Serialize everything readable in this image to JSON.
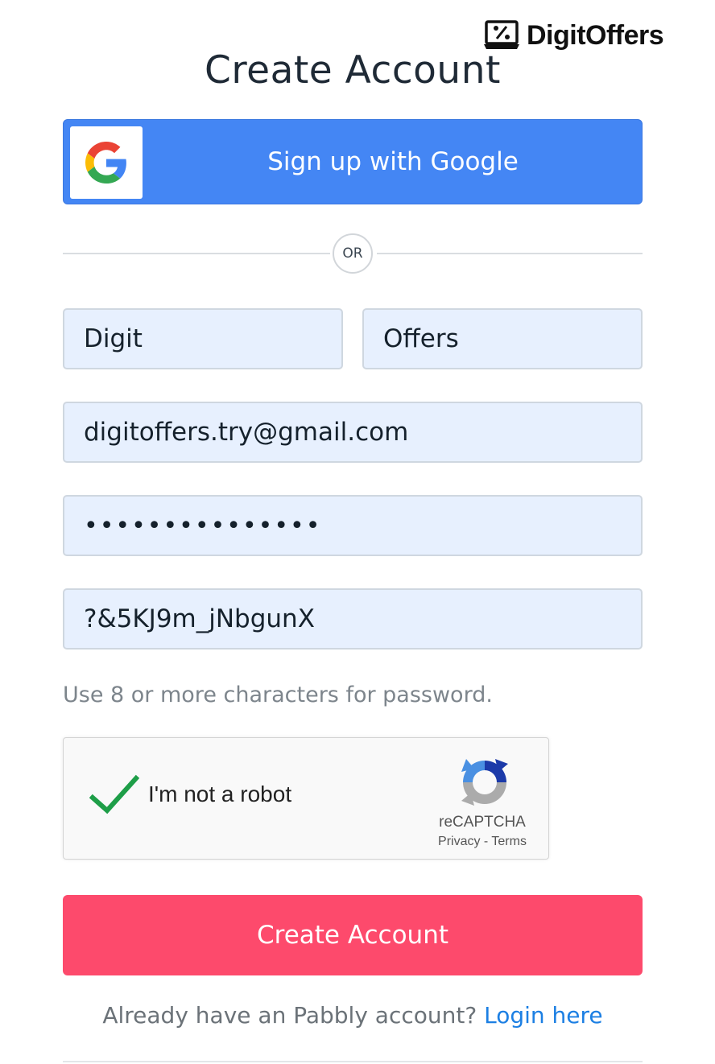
{
  "brand": {
    "name": "DigitOffers",
    "icon": "percent-laptop-icon"
  },
  "page_title": "Create Account",
  "google_button": {
    "label": "Sign up with Google",
    "icon": "google-g-icon"
  },
  "divider": {
    "label": "OR"
  },
  "form": {
    "first_name": {
      "value": "Digit"
    },
    "last_name": {
      "value": "Offers"
    },
    "email": {
      "value": "digitoffers.try@gmail.com"
    },
    "password": {
      "value": "•••••••••••••••"
    },
    "confirm_password": {
      "value": "?&5KJ9m_jNbgunX"
    },
    "password_hint": "Use 8 or more characters for password."
  },
  "captcha": {
    "label": "I'm not a robot",
    "checked": true,
    "brand": "reCAPTCHA",
    "privacy": "Privacy",
    "separator": " - ",
    "terms": "Terms"
  },
  "submit_button": {
    "label": "Create Account"
  },
  "login_prompt": {
    "text": "Already have an Pabbly account? ",
    "link": "Login here"
  },
  "colors": {
    "google_blue": "#4486f4",
    "submit_pink": "#fd4a6c",
    "field_background": "#e7f0fe",
    "link_blue": "#1c7fe3",
    "check_green": "#1e9e48"
  }
}
